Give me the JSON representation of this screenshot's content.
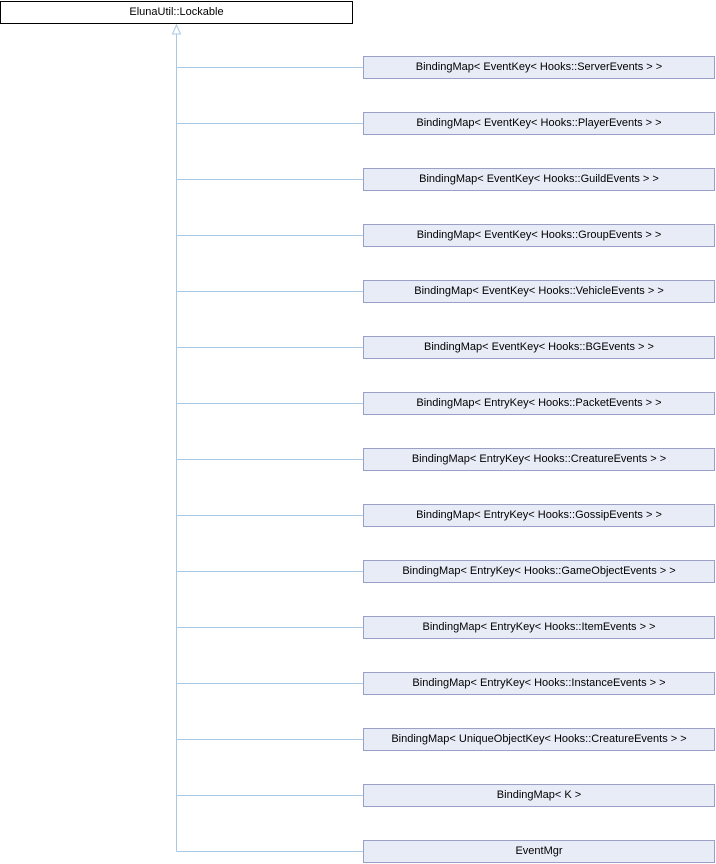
{
  "diagram": {
    "base_class": {
      "name": "ElunaUtil::Lockable"
    },
    "derived_classes": [
      {
        "name": "BindingMap< EventKey< Hooks::ServerEvents > >"
      },
      {
        "name": "BindingMap< EventKey< Hooks::PlayerEvents > >"
      },
      {
        "name": "BindingMap< EventKey< Hooks::GuildEvents > >"
      },
      {
        "name": "BindingMap< EventKey< Hooks::GroupEvents > >"
      },
      {
        "name": "BindingMap< EventKey< Hooks::VehicleEvents > >"
      },
      {
        "name": "BindingMap< EventKey< Hooks::BGEvents > >"
      },
      {
        "name": "BindingMap< EntryKey< Hooks::PacketEvents > >"
      },
      {
        "name": "BindingMap< EntryKey< Hooks::CreatureEvents > >"
      },
      {
        "name": "BindingMap< EntryKey< Hooks::GossipEvents > >"
      },
      {
        "name": "BindingMap< EntryKey< Hooks::GameObjectEvents > >"
      },
      {
        "name": "BindingMap< EntryKey< Hooks::ItemEvents > >"
      },
      {
        "name": "BindingMap< EntryKey< Hooks::InstanceEvents > >"
      },
      {
        "name": "BindingMap< UniqueObjectKey< Hooks::CreatureEvents > >"
      },
      {
        "name": "BindingMap< K >"
      },
      {
        "name": "EventMgr"
      }
    ],
    "colors": {
      "node_fill": "#e8ecf7",
      "node_border": "#9aa0c8",
      "root_border": "#000000",
      "edge": "#a9c8e4"
    }
  }
}
